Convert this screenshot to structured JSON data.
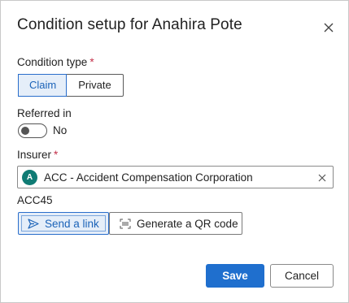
{
  "dialog": {
    "title": "Condition setup for Anahira Pote",
    "close_icon": "close-icon"
  },
  "condition_type": {
    "label": "Condition type",
    "required_mark": "*",
    "options": [
      "Claim",
      "Private"
    ],
    "selected": "Claim"
  },
  "referred_in": {
    "label": "Referred in",
    "state_text": "No",
    "on": false
  },
  "insurer": {
    "label": "Insurer",
    "required_mark": "*",
    "avatar_letter": "A",
    "value": "ACC - Accident Compensation Corporation",
    "clear_icon": "clear-icon"
  },
  "acc45": {
    "label": "ACC45",
    "send_link_label": "Send a link",
    "send_link_icon": "send-icon",
    "qr_label": "Generate a QR code",
    "qr_icon": "qr-code-icon"
  },
  "footer": {
    "save_label": "Save",
    "cancel_label": "Cancel"
  },
  "colors": {
    "primary": "#1f6fce",
    "selected_bg": "#e5eef9",
    "required": "#c4314b",
    "avatar_bg": "#0f7b74"
  }
}
